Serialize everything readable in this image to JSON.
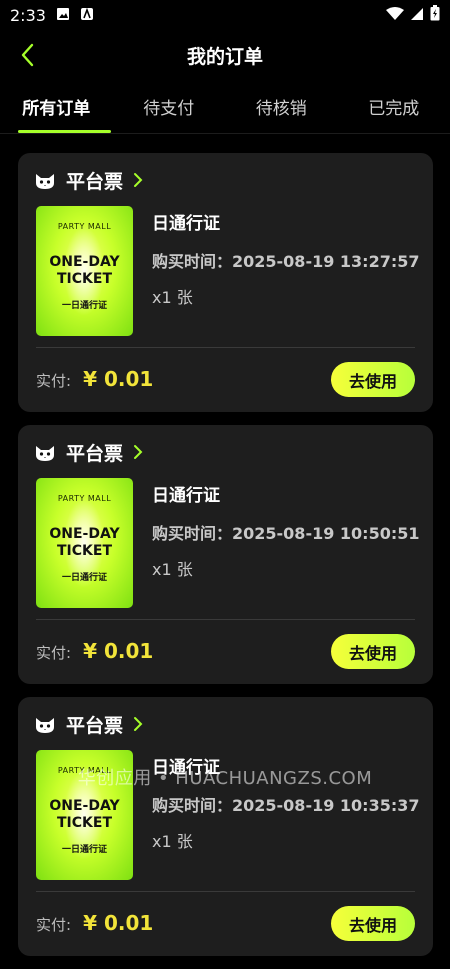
{
  "status_bar": {
    "time": "2:33"
  },
  "header": {
    "title": "我的订单"
  },
  "tabs": [
    {
      "label": "所有订单",
      "active": true
    },
    {
      "label": "待支付",
      "active": false
    },
    {
      "label": "待核销",
      "active": false
    },
    {
      "label": "已完成",
      "active": false
    }
  ],
  "orders": [
    {
      "shop": "平台票",
      "ticket": {
        "mall": "PARTY MALL",
        "line1": "ONE-DAY",
        "line2": "TICKET",
        "sub": "一日通行证"
      },
      "product": "日通行证",
      "buy_time": "购买时间：2025-08-19 13:27:57",
      "qty": "x1 张",
      "paid_label": "实付:",
      "price": "¥ 0.01",
      "action": "去使用"
    },
    {
      "shop": "平台票",
      "ticket": {
        "mall": "PARTY MALL",
        "line1": "ONE-DAY",
        "line2": "TICKET",
        "sub": "一日通行证"
      },
      "product": "日通行证",
      "buy_time": "购买时间：2025-08-19 10:50:51",
      "qty": "x1 张",
      "paid_label": "实付:",
      "price": "¥ 0.01",
      "action": "去使用"
    },
    {
      "shop": "平台票",
      "ticket": {
        "mall": "PARTY MALL",
        "line1": "ONE-DAY",
        "line2": "TICKET",
        "sub": "一日通行证"
      },
      "product": "日通行证",
      "buy_time": "购买时间：2025-08-19 10:35:37",
      "qty": "x1 张",
      "paid_label": "实付:",
      "price": "¥ 0.01",
      "action": "去使用"
    }
  ],
  "watermark": "华创应用 • HUACHUANGZS.COM",
  "colors": {
    "accent": "#a6ff2a",
    "price": "#f2e43a",
    "card": "#1e1e1e"
  }
}
